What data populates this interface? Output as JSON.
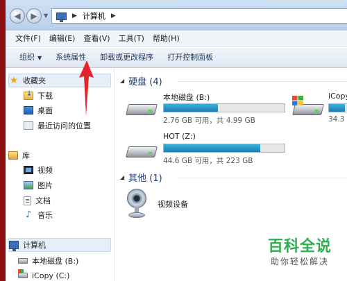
{
  "address": {
    "path": "计算机"
  },
  "menu": [
    "文件(F)",
    "编辑(E)",
    "查看(V)",
    "工具(T)",
    "帮助(H)"
  ],
  "toolbar": {
    "organize": "组织",
    "system_properties": "系统属性",
    "uninstall": "卸载或更改程序",
    "control_panel": "打开控制面板"
  },
  "nav": {
    "favorites": "收藏夹",
    "downloads": "下载",
    "desktop": "桌面",
    "recent": "最近访问的位置",
    "libraries": "库",
    "videos": "视频",
    "pictures": "图片",
    "documents": "文档",
    "music": "音乐",
    "computer": "计算机",
    "local_disk": "本地磁盘 (B:)",
    "icopy": "iCopy (C:)"
  },
  "content": {
    "hard_disks_header": "硬盘 (4)",
    "drives": [
      {
        "name": "本地磁盘 (B:)",
        "info": "2.76 GB 可用，共 4.99 GB",
        "used_fraction": 0.45
      },
      {
        "name": "iCopy",
        "info": "34.3",
        "used_fraction": 0.6
      },
      {
        "name": "HOT (Z:)",
        "info": "44.6 GB 可用，共 223 GB",
        "used_fraction": 0.8
      }
    ],
    "other_header": "其他 (1)",
    "device": "视频设备"
  },
  "watermark": {
    "title": "百科全说",
    "subtitle": "助你轻松解决"
  },
  "colors": {
    "arrow": "#e2242b",
    "bar": "#1f8fc6",
    "watermark": "#2fb04f"
  }
}
